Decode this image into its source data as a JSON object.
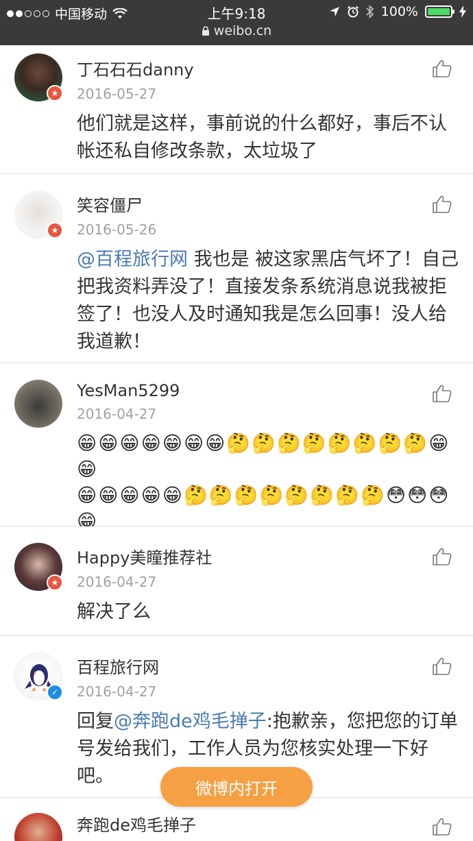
{
  "status_bar": {
    "carrier": "中国移动",
    "time": "上午9:18",
    "url": "weibo.cn",
    "battery": "100%"
  },
  "comments": [
    {
      "name": "丁石石石danny",
      "date": "2016-05-27",
      "text": "他们就是这样，事前说的什么都好，事后不认帐还私自修改条款，太垃圾了",
      "verified": "red"
    },
    {
      "name": "笑容僵尸",
      "date": "2016-05-26",
      "mention": "@百程旅行网",
      "text": " 我也是 被这家黑店气坏了！自己把我资料弄没了！直接发条系统消息说我被拒签了！也没人及时通知我是怎么回事！没人给我道歉！",
      "verified": "red"
    },
    {
      "name": "YesMan5299",
      "date": "2016-04-27",
      "emoji_lines": [
        "😁😁😁😁😁😁😁🤔🤔🤔🤔🤔🤔🤔🤔😁😁",
        "😁😁😁😁😁🤔🤔🤔🤔🤔🤔🤔🤔😳😳😳😁",
        "😳😳😁😁😁😁😁😁😁"
      ],
      "verified": ""
    },
    {
      "name": "Happy美瞳推荐社",
      "date": "2016-04-27",
      "text": "解决了么",
      "verified": "red"
    },
    {
      "name": "百程旅行网",
      "date": "2016-04-27",
      "reply_prefix": "回复",
      "mention": "@奔跑de鸡毛掸子",
      "text": ":抱歉亲，您把您的订单号发给我们，工作人员为您核实处理一下好吧。",
      "verified": "blue"
    },
    {
      "name": "奔跑de鸡毛掸子",
      "date": "",
      "text": "",
      "verified": ""
    }
  ],
  "open_button": "微博内打开",
  "icons": {
    "like": "thumbs-up-icon",
    "lock": "lock-icon",
    "wifi": "wifi-icon",
    "location": "location-arrow-icon",
    "alarm": "alarm-icon",
    "bluetooth": "bluetooth-icon"
  },
  "colors": {
    "status_bar": "#3a3a3a",
    "mention": "#4a7bb3",
    "open_button": "#f5a042"
  }
}
